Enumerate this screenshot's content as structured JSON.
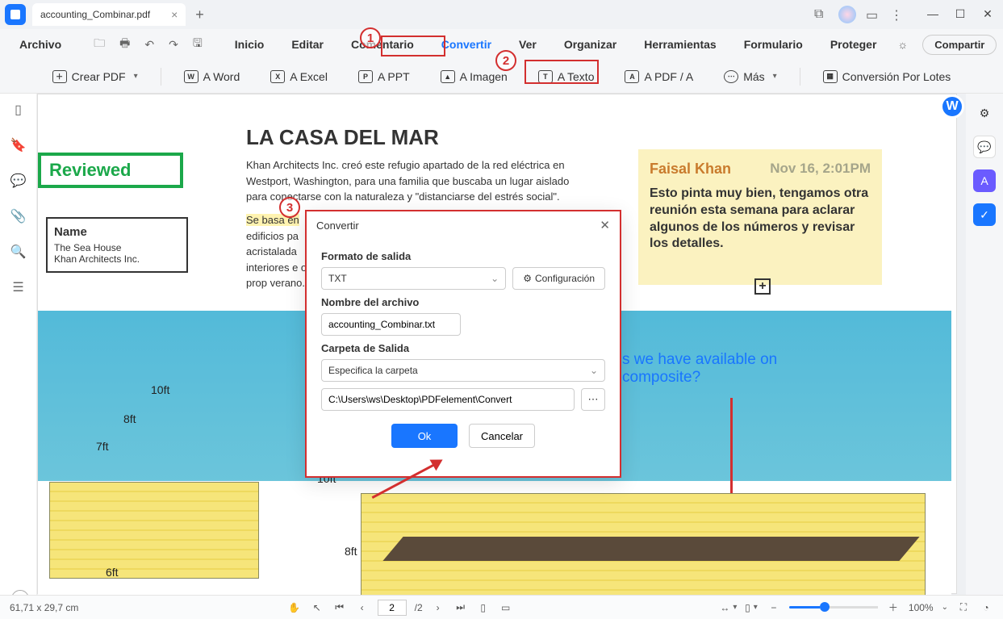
{
  "titlebar": {
    "tab_name": "accounting_Combinar.pdf"
  },
  "menu": {
    "file": "Archivo",
    "items": [
      "Inicio",
      "Editar",
      "Comentario",
      "Convertir",
      "Ver",
      "Organizar",
      "Herramientas",
      "Formulario",
      "Proteger"
    ],
    "share": "Compartir"
  },
  "ribbon": {
    "create": "Crear PDF",
    "word": "A Word",
    "excel": "A Excel",
    "ppt": "A PPT",
    "image": "A Imagen",
    "text": "A Texto",
    "pdfa": "A PDF / A",
    "more": "Más",
    "batch": "Conversión Por Lotes"
  },
  "doc": {
    "title": "LA CASA DEL MAR",
    "para1": "Khan Architects Inc. creó este refugio apartado de la red eléctrica en Westport, Washington, para una familia que buscaba un lugar aislado para conectarse con la naturaleza y \"distanciarse del estrés social\".",
    "para2_hl": "Se basa en",
    "para2_rest": " edificios pa acristalada interiores e oeste prop verano.",
    "reviewed": "Reviewed",
    "name_label": "Name",
    "name_line1": "The Sea House",
    "name_line2": "Khan Architects Inc.",
    "sticky_author": "Faisal Khan",
    "sticky_date": "Nov 16, 2:01PM",
    "sticky_body": "Esto pinta muy bien, tengamos otra reunión esta semana para aclarar algunos de los números y revisar los detalles.",
    "question": "s we have available on composite?",
    "d10": "10ft",
    "d8": "8ft",
    "d7": "7ft",
    "d6": "6ft",
    "d10b": "10ft",
    "d8b": "8ft"
  },
  "modal": {
    "title": "Convertir",
    "format_label": "Formato de salida",
    "format_value": "TXT",
    "config": "Configuración",
    "name_label": "Nombre del archivo",
    "name_value": "accounting_Combinar.txt",
    "folder_label": "Carpeta de Salida",
    "folder_select": "Especifica la carpeta",
    "folder_path": "C:\\Users\\ws\\Desktop\\PDFelement\\Convert",
    "ok": "Ok",
    "cancel": "Cancelar"
  },
  "annotations": {
    "a1": "1",
    "a2": "2",
    "a3": "3"
  },
  "status": {
    "dims": "61,71 x 29,7 cm",
    "page_cur": "2",
    "page_total": "/2",
    "zoom": "100%"
  }
}
